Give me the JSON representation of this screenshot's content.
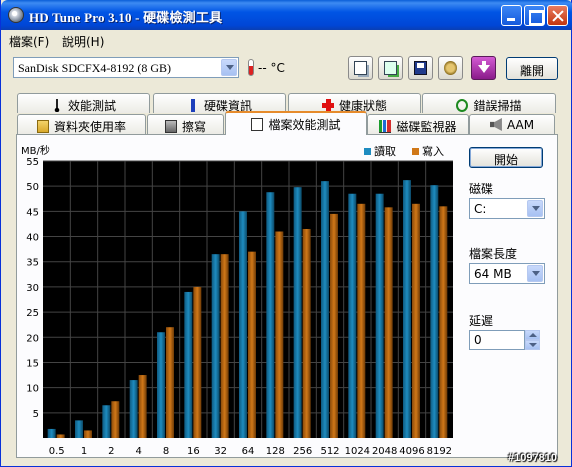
{
  "window": {
    "title": "HD Tune Pro 3.10 - 硬碟檢測工具"
  },
  "menu": {
    "file": "檔案(F)",
    "help": "說明(H)"
  },
  "toolbar": {
    "drive": "SanDisk SDCFX4-8192 (8 GB)",
    "temperature": "-- °C",
    "exit_label": "離開"
  },
  "tabs": {
    "row1": [
      "效能測試",
      "硬碟資訊",
      "健康狀態",
      "錯誤掃描"
    ],
    "row2": [
      "資料夾使用率",
      "擦寫",
      "檔案效能測試",
      "磁碟監視器",
      "AAM"
    ]
  },
  "controls": {
    "start_label": "開始",
    "drive_label": "磁碟",
    "drive_value": "C:",
    "file_length_label": "檔案長度",
    "file_length_value": "64 MB",
    "delay_label": "延遲",
    "delay_value": "0"
  },
  "watermark": "#1097810",
  "chart_data": {
    "type": "bar",
    "ylabel": "MB/秒",
    "ylim": [
      0,
      55
    ],
    "yticks": [
      5,
      10,
      15,
      20,
      25,
      30,
      35,
      40,
      45,
      50,
      55
    ],
    "categories": [
      "0.5",
      "1",
      "2",
      "4",
      "8",
      "16",
      "32",
      "64",
      "128",
      "256",
      "512",
      "1024",
      "2048",
      "4096",
      "8192"
    ],
    "series": [
      {
        "name": "讀取",
        "color": "#1e8cc0",
        "values": [
          1.8,
          3.5,
          6.5,
          11.5,
          21,
          29,
          36.5,
          45,
          48.8,
          49.8,
          51,
          48.5,
          48.5,
          51.2,
          50.2
        ]
      },
      {
        "name": "寫入",
        "color": "#d07818",
        "values": [
          0.7,
          1.5,
          7.3,
          12.5,
          22,
          30,
          36.5,
          37,
          41,
          41.5,
          44.5,
          46.5,
          45.8,
          46.5,
          46
        ]
      }
    ],
    "grid": true,
    "legend": "top-right"
  }
}
